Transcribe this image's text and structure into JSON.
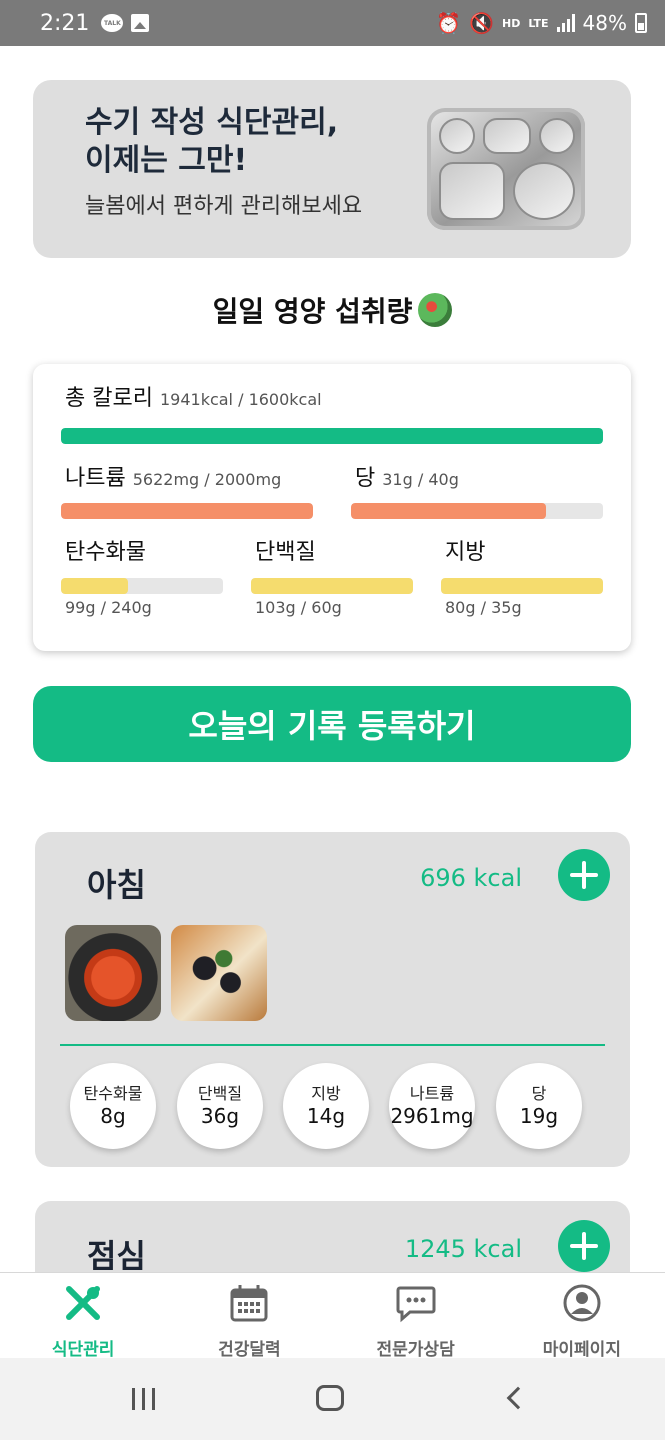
{
  "status_bar": {
    "time": "2:21",
    "talk_label": "TALK",
    "hd_label": "HD",
    "lte_label": "LTE",
    "battery": "48%"
  },
  "banner": {
    "title": "수기 작성 식단관리,\n이제는 그만!",
    "subtitle": "늘봄에서 편하게 관리해보세요"
  },
  "section_title": "일일 영양 섭취량",
  "nutrition": {
    "calories": {
      "label": "총 칼로리",
      "value": "1941kcal / 1600kcal",
      "ratio": 1.0,
      "color": "#14bb85"
    },
    "sodium": {
      "label": "나트륨",
      "value": "5622mg / 2000mg",
      "ratio": 1.0,
      "color": "#f58f68"
    },
    "sugar": {
      "label": "당",
      "value": "31g / 40g",
      "ratio": 0.775,
      "color": "#f58f68"
    },
    "carbs": {
      "label": "탄수화물",
      "value": "99g / 240g",
      "ratio": 0.4125,
      "color": "#f5dc6e"
    },
    "protein": {
      "label": "단백질",
      "value": "103g / 60g",
      "ratio": 1.0,
      "color": "#f5dc6e"
    },
    "fat": {
      "label": "지방",
      "value": "80g / 35g",
      "ratio": 1.0,
      "color": "#f5dc6e"
    }
  },
  "register_button": "오늘의 기록 등록하기",
  "meals": {
    "breakfast": {
      "title": "아침",
      "kcal": "696 kcal",
      "nutrients": [
        {
          "label": "탄수화물",
          "value": "8g"
        },
        {
          "label": "단백질",
          "value": "36g"
        },
        {
          "label": "지방",
          "value": "14g"
        },
        {
          "label": "나트륨",
          "value": "2961mg"
        },
        {
          "label": "당",
          "value": "19g"
        }
      ]
    },
    "lunch": {
      "title": "점심",
      "kcal": "1245 kcal"
    }
  },
  "bottom_nav": {
    "items": [
      {
        "label": "식단관리",
        "icon": "utensils-icon",
        "active": true
      },
      {
        "label": "건강달력",
        "icon": "calendar-icon",
        "active": false
      },
      {
        "label": "전문가상담",
        "icon": "chat-icon",
        "active": false
      },
      {
        "label": "마이페이지",
        "icon": "user-icon",
        "active": false
      }
    ]
  },
  "colors": {
    "accent": "#14bb85",
    "warning": "#f58f68",
    "caution": "#f5dc6e",
    "card_bg": "#e0e0e0"
  }
}
